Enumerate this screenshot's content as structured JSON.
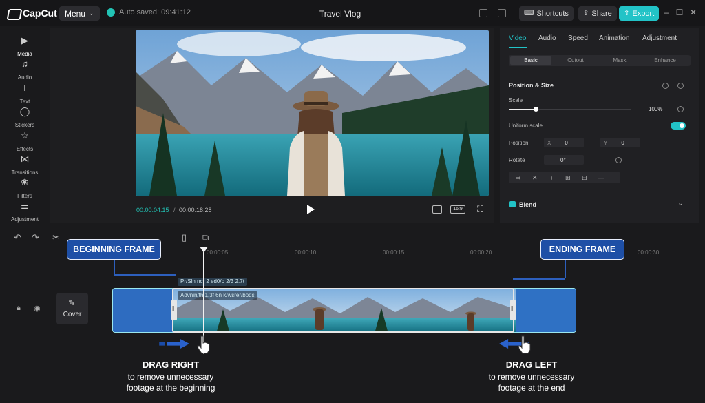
{
  "titlebar": {
    "app_name": "CapCut",
    "menu_label": "Menu",
    "autosave": "Auto saved: 09:41:12",
    "project_title": "Travel Vlog",
    "shortcuts_label": "Shortcuts",
    "share_label": "Share",
    "export_label": "Export"
  },
  "left_tools": [
    {
      "label": "Media",
      "icon": "media-icon"
    },
    {
      "label": "Audio",
      "icon": "audio-icon"
    },
    {
      "label": "Text",
      "icon": "text-icon"
    },
    {
      "label": "Stickers",
      "icon": "stickers-icon"
    },
    {
      "label": "Effects",
      "icon": "effects-icon"
    },
    {
      "label": "Transitions",
      "icon": "transitions-icon"
    },
    {
      "label": "Filters",
      "icon": "filters-icon"
    },
    {
      "label": "Adjustment",
      "icon": "adjustment-icon"
    }
  ],
  "player": {
    "current_time": "00:00:04:15",
    "separator": "/",
    "total_time": "00:00:18:28",
    "aspect_ratio": "16:9"
  },
  "right_panel": {
    "tabs": [
      "Video",
      "Audio",
      "Speed",
      "Animation",
      "Adjustment"
    ],
    "active_tab": "Video",
    "subtabs": [
      "Basic",
      "Cutout",
      "Mask",
      "Enhance"
    ],
    "active_subtab": "Basic",
    "position_size_heading": "Position & Size",
    "scale_label": "Scale",
    "scale_value": "100%",
    "uniform_scale_label": "Uniform scale",
    "uniform_scale_on": true,
    "position_label": "Position",
    "pos_x_label": "X",
    "pos_x_value": "0",
    "pos_y_label": "Y",
    "pos_y_value": "0",
    "rotate_label": "Rotate",
    "rotate_value": "0°",
    "blend_label": "Blend"
  },
  "timeline": {
    "ticks": [
      "00:00:05",
      "00:00:10",
      "00:00:15",
      "00:00:20",
      "00:00:30"
    ],
    "cover_label": "Cover",
    "clip_tag_top": "Pr/Sln ncr 2 ed0/p 2/3 2.7t",
    "clip_tag_main": "Advnin/th 1.3f 6n k/wsrer/bods"
  },
  "annotations": {
    "beginning_frame": "BEGINNING FRAME",
    "ending_frame": "ENDING FRAME",
    "drag_right_title": "DRAG RIGHT",
    "drag_right_line1": "to remove unnecessary",
    "drag_right_line2": "footage at the beginning",
    "drag_left_title": "DRAG LEFT",
    "drag_left_line1": "to remove unnecessary",
    "drag_left_line2": "footage at the end"
  },
  "colors": {
    "accent": "#22c3c7",
    "callout_blue": "#1e4fa6",
    "background": "#1a1a1c"
  }
}
